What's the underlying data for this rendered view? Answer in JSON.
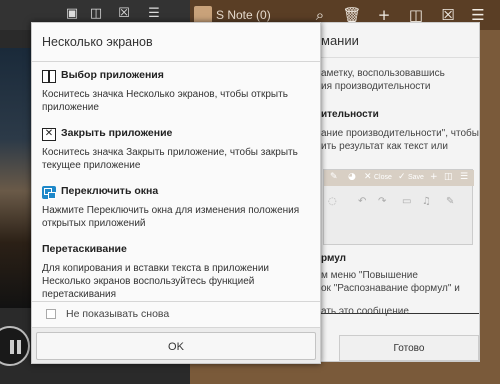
{
  "status_bar": {
    "snote_title": "S Note (0)"
  },
  "dialog": {
    "title": "Несколько экранов",
    "sections": [
      {
        "icon": "window-split-icon",
        "title": "Выбор приложения",
        "body": "Коснитесь значка Несколько экранов, чтобы открыть приложение"
      },
      {
        "icon": "close-window-icon",
        "title": "Закрыть приложение",
        "body": "Коснитесь значка Закрыть приложение, чтобы закрыть текущее приложение"
      },
      {
        "icon": "switch-windows-icon",
        "title": "Переключить окна",
        "body": "Нажмите Переключить окна для изменения положения открытых приложений"
      },
      {
        "icon": "",
        "title": "Перетаскивание",
        "body": "Для копирования и вставки текста в приложении Несколько экранов воспользуйтесь функцией перетаскивания"
      }
    ],
    "checkbox_label": "Не показывать снова",
    "checkbox_checked": false,
    "ok_label": "OK"
  },
  "right_dialog": {
    "title": "мании",
    "line1": "аметку, воспользовавшись",
    "line2": "ия производительности",
    "header": "ительности",
    "line3": "ание производительности\", чтобы",
    "line4": "ить результат как текст или",
    "shot_close": "Close",
    "shot_save": "Save",
    "header2": "рмул",
    "line5": "м меню \"Повышение",
    "line6": "ок \"Распознавание формул\" и",
    "line7": "ать это сообщение",
    "done_label": "Готово"
  },
  "colors": {
    "accent_blue": "#1e88c9",
    "dialog_bg": "#fafafa",
    "snote_bar": "#5a3e25"
  }
}
